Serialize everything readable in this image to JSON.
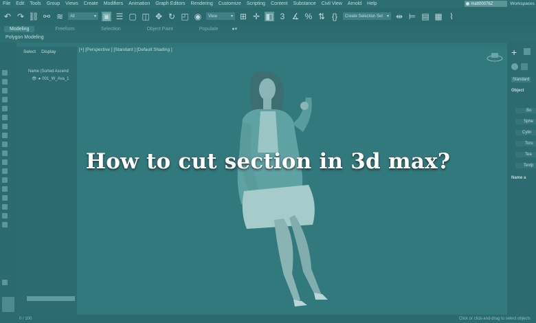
{
  "menubar": {
    "items": [
      "File",
      "Edit",
      "Tools",
      "Group",
      "Views",
      "Create",
      "Modifiers",
      "Animation",
      "Graph Editors",
      "Rendering",
      "Customize",
      "Scripting",
      "Content",
      "Substance",
      "Civil View",
      "Arnold",
      "Help"
    ],
    "user": "matt00076Z",
    "workspaces": "Workspaces"
  },
  "toolbar": {
    "filter_select": "All",
    "view_select": "View",
    "selection_set": "Create Selection Set"
  },
  "ribbon": {
    "tabs": [
      "Modeling",
      "Freeform",
      "Selection",
      "Object Paint",
      "Populate"
    ],
    "sub_label": "Polygon Modeling"
  },
  "scene_explorer": {
    "tabs": [
      "Select",
      "Display"
    ],
    "column_header": "Name (Sorted Ascend",
    "row": "001_W_Ava_1"
  },
  "viewport": {
    "label": "[+] [Perspective ] [Standard ] [Default Shading ]"
  },
  "command_panel": {
    "section_object_type": "Object",
    "section_name_color": "Name a",
    "dropdown": "Standard",
    "items": [
      "Bo",
      "Sphe",
      "Cylin",
      "Toru",
      "Tea",
      "Textp"
    ]
  },
  "statusbar": {
    "left": "0 / 100",
    "right": "Click or click-and-drag to select objects"
  },
  "headline": "How to cut section in 3d max?"
}
